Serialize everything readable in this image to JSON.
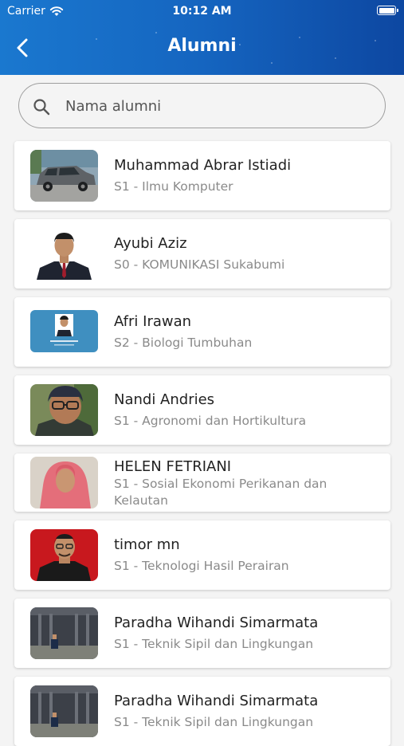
{
  "status_bar": {
    "carrier": "Carrier",
    "time": "10:12 AM"
  },
  "header": {
    "title": "Alumni",
    "back_icon": "chevron-left-icon"
  },
  "search": {
    "placeholder": "Nama alumni",
    "value": ""
  },
  "alumni": [
    {
      "name": "Muhammad Abrar Istiadi",
      "program": "S1 - Ilmu Komputer",
      "photo": "car-photo"
    },
    {
      "name": "Ayubi Aziz",
      "program": "S0 - KOMUNIKASI Sukabumi",
      "photo": "portrait-suit"
    },
    {
      "name": "Afri Irawan",
      "program": "S2 - Biologi Tumbuhan",
      "photo": "id-card"
    },
    {
      "name": "Nandi Andries",
      "program": "S1 - Agronomi dan Hortikultura",
      "photo": "portrait-glasses"
    },
    {
      "name": "HELEN FETRIANI",
      "program": "S1 - Sosial Ekonomi Perikanan dan Kelautan",
      "photo": "portrait-hijab"
    },
    {
      "name": "timor mn",
      "program": "S1 - Teknologi Hasil Perairan",
      "photo": "portrait-red"
    },
    {
      "name": "Paradha Wihandi Simarmata",
      "program": "S1 - Teknik Sipil dan Lingkungan",
      "photo": "building"
    },
    {
      "name": "Paradha Wihandi Simarmata",
      "program": "S1 - Teknik Sipil dan Lingkungan",
      "photo": "building"
    }
  ]
}
